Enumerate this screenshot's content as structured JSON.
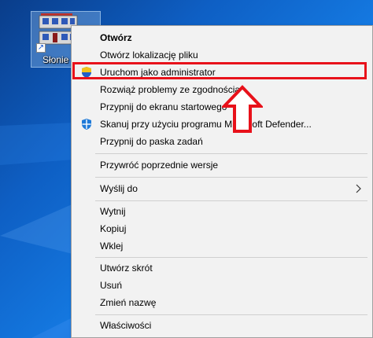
{
  "desktop": {
    "shortcut": {
      "label": "Słonie",
      "icon": "building-icon"
    }
  },
  "context_menu": {
    "items": [
      {
        "label": "Otwórz",
        "bold": true
      },
      {
        "label": "Otwórz lokalizację pliku"
      },
      {
        "label": "Uruchom jako administrator",
        "icon": "uac-shield-icon",
        "highlighted": true
      },
      {
        "label": "Rozwiąż problemy ze zgodnością"
      },
      {
        "label": "Przypnij do ekranu startowego"
      },
      {
        "label": "Skanuj przy użyciu programu Microsoft Defender...",
        "icon": "defender-icon"
      },
      {
        "label": "Przypnij do paska zadań"
      },
      {
        "label": "Przywróć poprzednie wersje"
      },
      {
        "label": "Wyślij do",
        "submenu": true
      },
      {
        "label": "Wytnij"
      },
      {
        "label": "Kopiuj"
      },
      {
        "label": "Wklej"
      },
      {
        "label": "Utwórz skrót"
      },
      {
        "label": "Usuń"
      },
      {
        "label": "Zmień nazwę"
      },
      {
        "label": "Właściwości"
      }
    ]
  },
  "annotation": {
    "highlight_color": "#e8111a",
    "arrow": "up-arrow-icon"
  },
  "colors": {
    "menu_background": "#f2f2f2",
    "desktop_blue": "#1478e0"
  }
}
